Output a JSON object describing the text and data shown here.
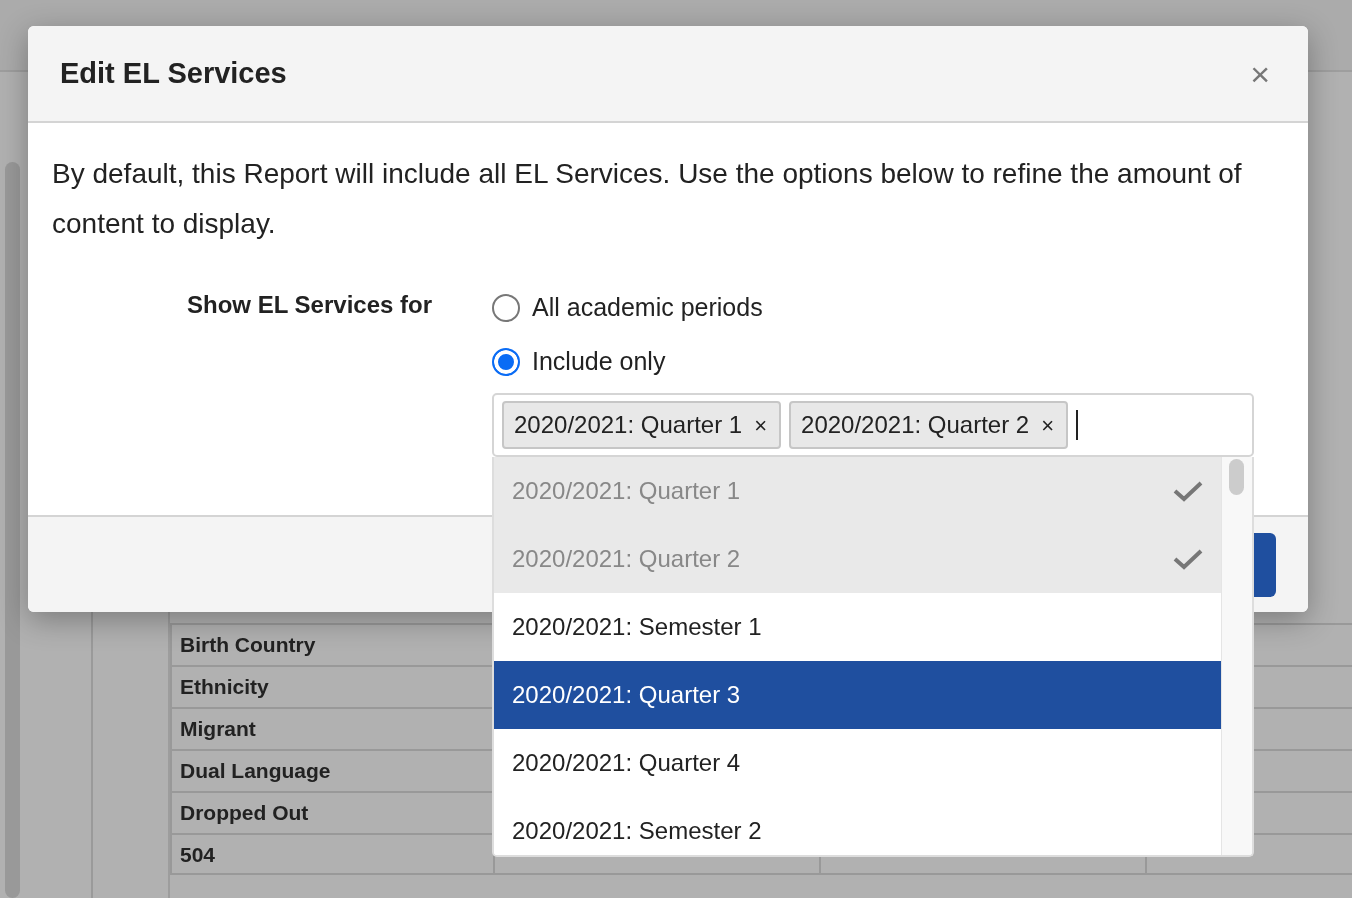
{
  "background_table": {
    "rows": [
      {
        "cells": [
          "Birth Country"
        ]
      },
      {
        "cells": [
          "Ethnicity"
        ]
      },
      {
        "cells": [
          "Migrant"
        ]
      },
      {
        "cells": [
          "Dual Language"
        ]
      },
      {
        "cells": [
          "Dropped Out"
        ]
      },
      {
        "cells": [
          "504"
        ]
      }
    ]
  },
  "dialog": {
    "title": "Edit EL Services",
    "close": "×",
    "description": "By default, this Report will include all EL Services. Use the options below to refine the amount of content to display.",
    "field_label": "Show EL Services for",
    "radios": [
      {
        "label": "All academic periods",
        "selected": false
      },
      {
        "label": "Include only",
        "selected": true
      }
    ],
    "tags": [
      {
        "label": "2020/2021: Quarter 1",
        "remove": "×"
      },
      {
        "label": "2020/2021: Quarter 2",
        "remove": "×"
      }
    ],
    "options": [
      {
        "label": "2020/2021: Quarter 1",
        "checked": true,
        "highlighted": false
      },
      {
        "label": "2020/2021: Quarter 2",
        "checked": true,
        "highlighted": false
      },
      {
        "label": "2020/2021: Semester 1",
        "checked": false,
        "highlighted": false
      },
      {
        "label": "2020/2021: Quarter 3",
        "checked": false,
        "highlighted": true
      },
      {
        "label": "2020/2021: Quarter 4",
        "checked": false,
        "highlighted": false
      },
      {
        "label": "2020/2021: Semester 2",
        "checked": false,
        "highlighted": false
      }
    ]
  }
}
